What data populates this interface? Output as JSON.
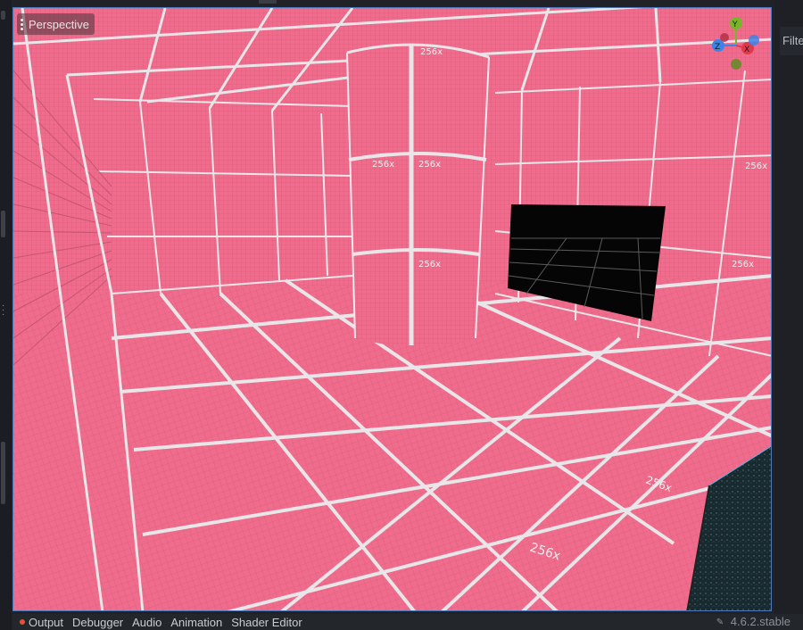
{
  "viewport": {
    "view_label": "Perspective",
    "grid_labels": [
      "256x",
      "256x",
      "256x",
      "256x",
      "256x",
      "256x",
      "256x",
      "256x"
    ],
    "gizmo_axes": {
      "y": "Y",
      "x": "X",
      "z": "Z"
    },
    "colors": {
      "surface": "#f06c8c",
      "grid_line": "#e6e6e6",
      "axis_y": "#7ab42a",
      "axis_x": "#e0394a",
      "axis_z": "#3c83e8"
    }
  },
  "inspector": {
    "filter_label": "Filte"
  },
  "bottom_panel": {
    "tabs": [
      {
        "label": "Output",
        "has_indicator": true
      },
      {
        "label": "Debugger"
      },
      {
        "label": "Audio"
      },
      {
        "label": "Animation"
      },
      {
        "label": "Shader Editor"
      }
    ],
    "version": "4.6.2.stable"
  }
}
